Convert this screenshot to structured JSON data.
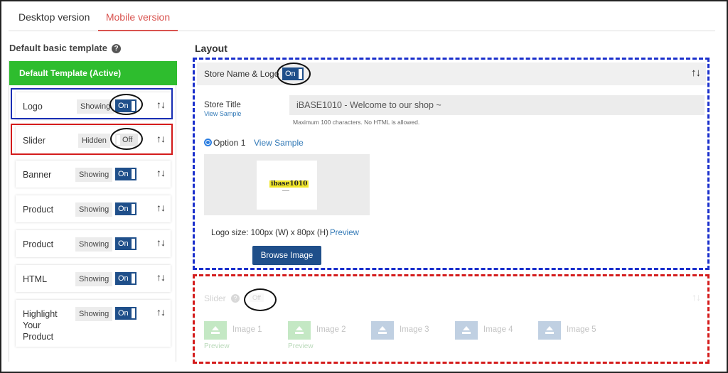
{
  "tabs": [
    "Desktop version",
    "Mobile version"
  ],
  "left": {
    "heading": "Default basic template",
    "active_template": "Default Template (Active)",
    "arrows": "↑↓",
    "items": [
      {
        "label": "Logo",
        "status": "Showing",
        "toggle": "On"
      },
      {
        "label": "Slider",
        "status": "Hidden",
        "toggle": "Off"
      },
      {
        "label": "Banner",
        "status": "Showing",
        "toggle": "On"
      },
      {
        "label": "Product",
        "status": "Showing",
        "toggle": "On"
      },
      {
        "label": "Product",
        "status": "Showing",
        "toggle": "On"
      },
      {
        "label": "HTML",
        "status": "Showing",
        "toggle": "On"
      },
      {
        "label": "Highlight Your Product",
        "status": "Showing",
        "toggle": "On"
      }
    ]
  },
  "layout": {
    "heading": "Layout",
    "store_section": {
      "title": "Store Name & Logo",
      "toggle": "On",
      "store_title_label": "Store Title",
      "view_sample_small": "View Sample",
      "store_title_value": "iBASE1010 - Welcome to our shop ~",
      "hint": "Maximum 100 characters. No HTML is allowed.",
      "option_label": "Option 1",
      "view_sample": "View Sample",
      "logo_text": "ibase1010",
      "logo_size": "Logo size: 100px (W) x 80px (H)",
      "preview": "Preview",
      "browse": "Browse Image"
    },
    "slider_section": {
      "title": "Slider",
      "toggle": "Off",
      "images": [
        "Image 1",
        "Image 2",
        "Image 3",
        "Image 4",
        "Image 5"
      ],
      "preview": "Preview"
    }
  },
  "colors": {
    "active_tab": "#d9534f",
    "active_template_bg": "#2ebd2e",
    "toggle_on": "#1f4f8a",
    "highlight_blue": "#1a2fcc",
    "highlight_red": "#d41b1b"
  }
}
